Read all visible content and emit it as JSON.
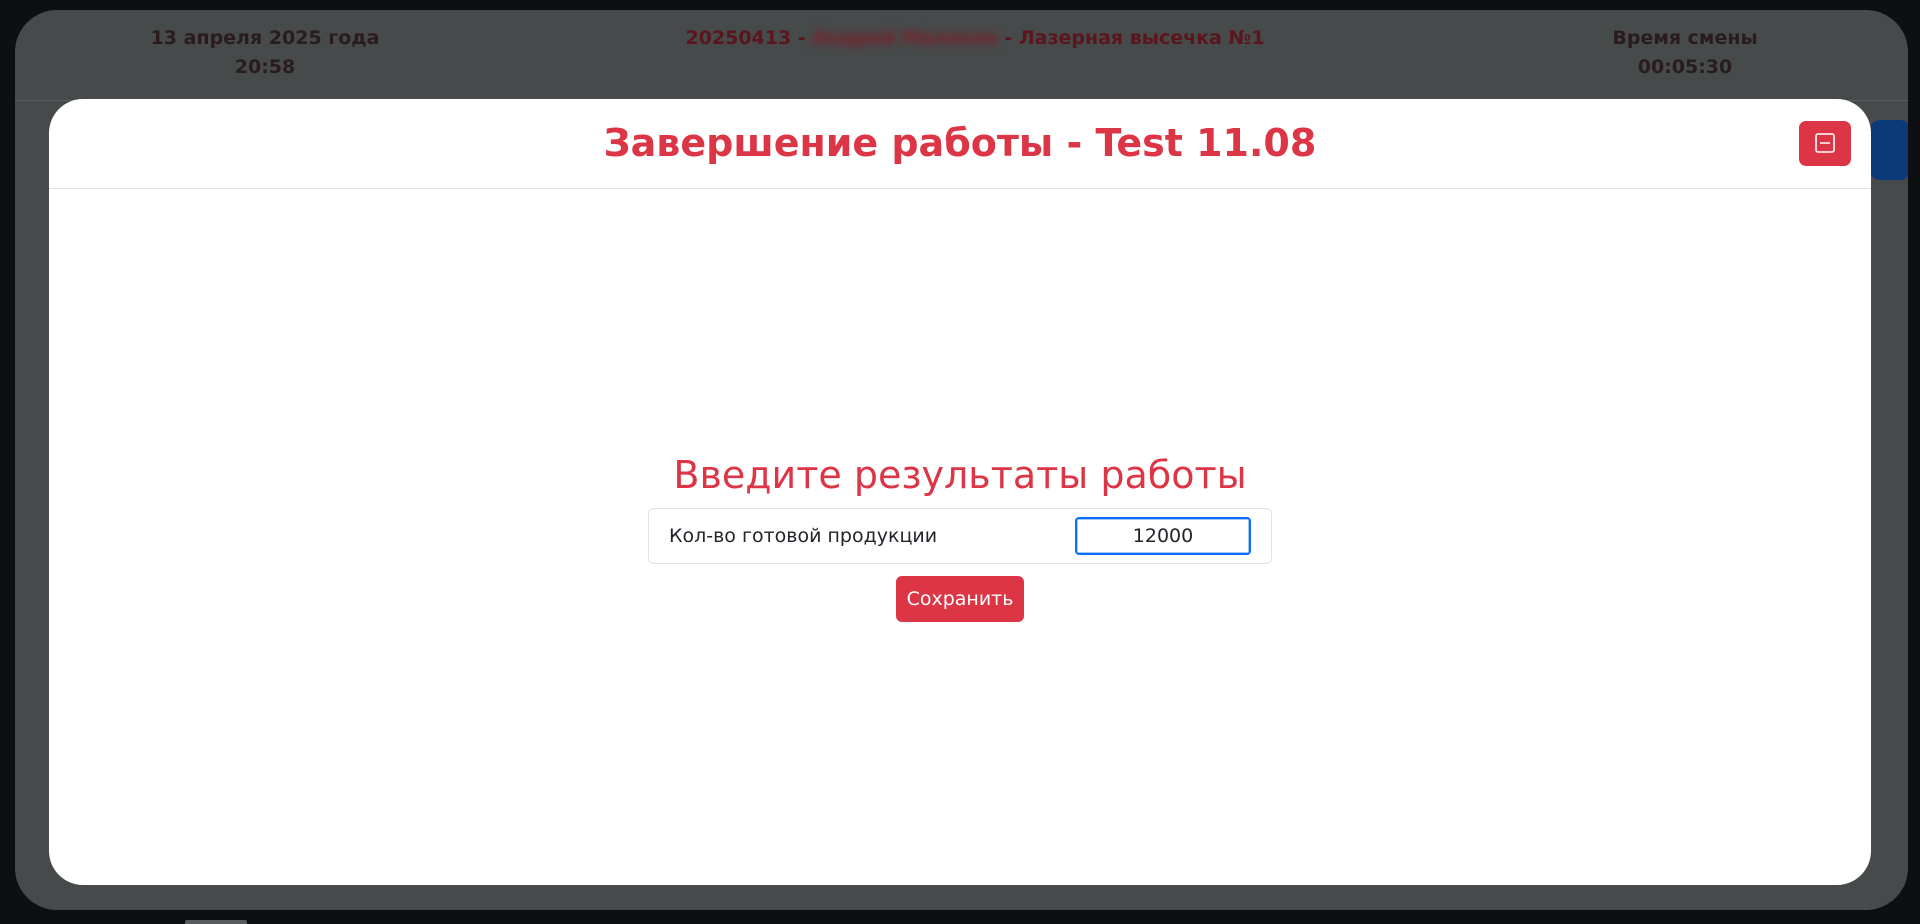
{
  "header": {
    "date": "13 апреля 2025 года",
    "time": "20:58",
    "shift_code": "20250413",
    "separator": " - ",
    "operator_name": "Андрей Малахов",
    "station": "Лазерная высечка №1",
    "shift_time_label": "Время смены",
    "shift_time_value": "00:05:30"
  },
  "modal": {
    "title": "Завершение работы - Test 11.08",
    "minimize_icon": "minus-square-icon",
    "heading": "Введите результаты работы",
    "field_label": "Кол-во готовой продукции",
    "field_value": "12000",
    "save_label": "Сохранить"
  },
  "colors": {
    "accent_red": "#dc3545",
    "focus_blue": "#0d6efd",
    "overlay": "#474a4b"
  }
}
